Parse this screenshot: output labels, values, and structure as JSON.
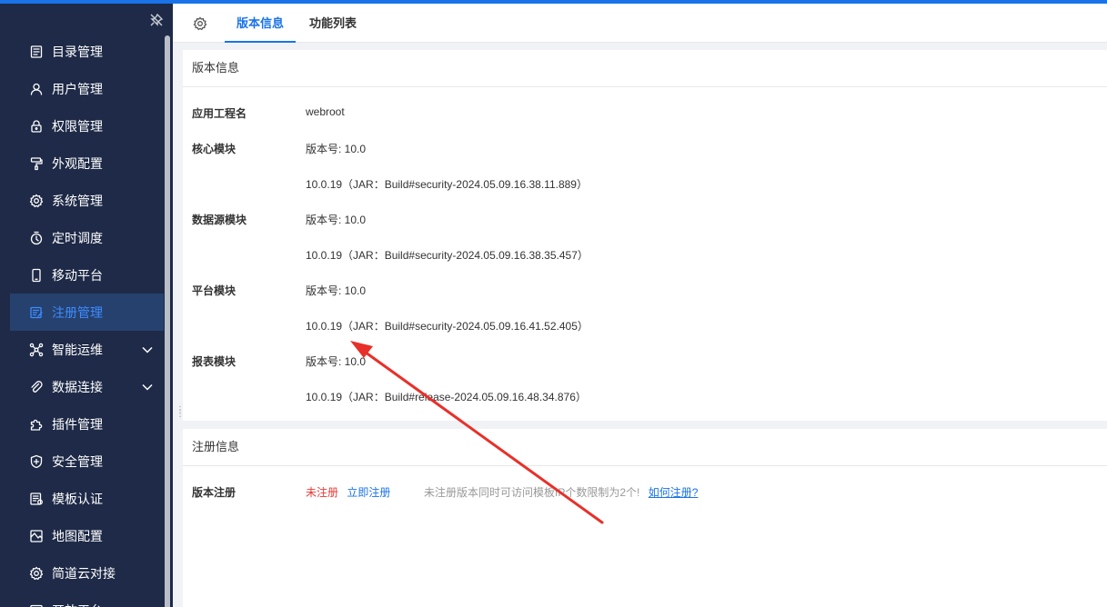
{
  "sidebar": {
    "items": [
      {
        "label": "目录管理",
        "icon": "catalog-icon"
      },
      {
        "label": "用户管理",
        "icon": "user-icon"
      },
      {
        "label": "权限管理",
        "icon": "lock-icon"
      },
      {
        "label": "外观配置",
        "icon": "paint-roller-icon"
      },
      {
        "label": "系统管理",
        "icon": "gear-icon"
      },
      {
        "label": "定时调度",
        "icon": "timer-icon"
      },
      {
        "label": "移动平台",
        "icon": "mobile-icon"
      },
      {
        "label": "注册管理",
        "icon": "register-icon",
        "active": true
      },
      {
        "label": "智能运维",
        "icon": "network-icon",
        "expandable": true
      },
      {
        "label": "数据连接",
        "icon": "link-icon",
        "expandable": true
      },
      {
        "label": "插件管理",
        "icon": "puzzle-icon"
      },
      {
        "label": "安全管理",
        "icon": "shield-icon"
      },
      {
        "label": "模板认证",
        "icon": "template-icon"
      },
      {
        "label": "地图配置",
        "icon": "map-icon"
      },
      {
        "label": "简道云对接",
        "icon": "gear-icon"
      },
      {
        "label": "开放平台",
        "icon": "platform-icon"
      }
    ],
    "colors": {
      "bg": "#1e2a47",
      "active_bg": "#27416e",
      "active_fg": "#3b8cff"
    }
  },
  "header": {
    "tabs": [
      {
        "label": "版本信息",
        "active": true
      },
      {
        "label": "功能列表",
        "active": false
      }
    ]
  },
  "version_panel": {
    "title": "版本信息",
    "rows": [
      {
        "label": "应用工程名",
        "value": "webroot"
      },
      {
        "label": "核心模块",
        "value": "版本号: 10.0"
      },
      {
        "label": "",
        "value": "10.0.19（JAR：Build#security-2024.05.09.16.38.11.889）"
      },
      {
        "label": "数据源模块",
        "value": "版本号: 10.0"
      },
      {
        "label": "",
        "value": "10.0.19（JAR：Build#security-2024.05.09.16.38.35.457）"
      },
      {
        "label": "平台模块",
        "value": "版本号: 10.0"
      },
      {
        "label": "",
        "value": "10.0.19（JAR：Build#security-2024.05.09.16.41.52.405）"
      },
      {
        "label": "报表模块",
        "value": "版本号: 10.0"
      },
      {
        "label": "",
        "value": "10.0.19（JAR：Build#release-2024.05.09.16.48.34.876）"
      }
    ]
  },
  "register_panel": {
    "title": "注册信息",
    "label": "版本注册",
    "status": "未注册",
    "register_link": "立即注册",
    "tip": "未注册版本同时可访问模板IP个数限制为2个!",
    "how_link": "如何注册?"
  },
  "accent_color": "#1a73e8",
  "annotation_color": "#e8302a"
}
